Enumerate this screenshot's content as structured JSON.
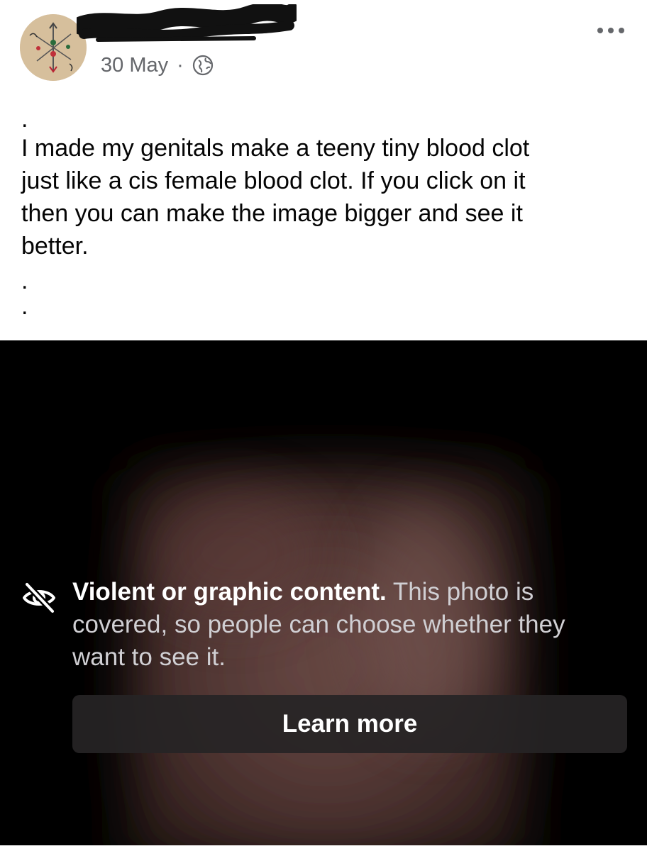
{
  "post": {
    "author_name": "",
    "date": "30 May",
    "separator": "·",
    "audience_icon": "globe-icon",
    "more_icon": "more-horizontal-icon",
    "text": {
      "top_dot": ".",
      "lines": [
        "I made my genitals make a teeny tiny blood clot",
        "just like a cis female blood clot. If you click on it",
        "then you can make the image bigger and see it",
        "better."
      ],
      "bottom_dots": [
        ".",
        "."
      ]
    }
  },
  "media": {
    "warning_icon": "eye-off-icon",
    "warning_title": "Violent or graphic content.",
    "warning_body": " This photo is covered, so people can choose whether they want to see it.",
    "learn_more_label": "Learn more"
  },
  "colors": {
    "text_primary": "#050505",
    "text_secondary": "#65676b",
    "media_background": "#000000",
    "button_background": "#262425"
  }
}
